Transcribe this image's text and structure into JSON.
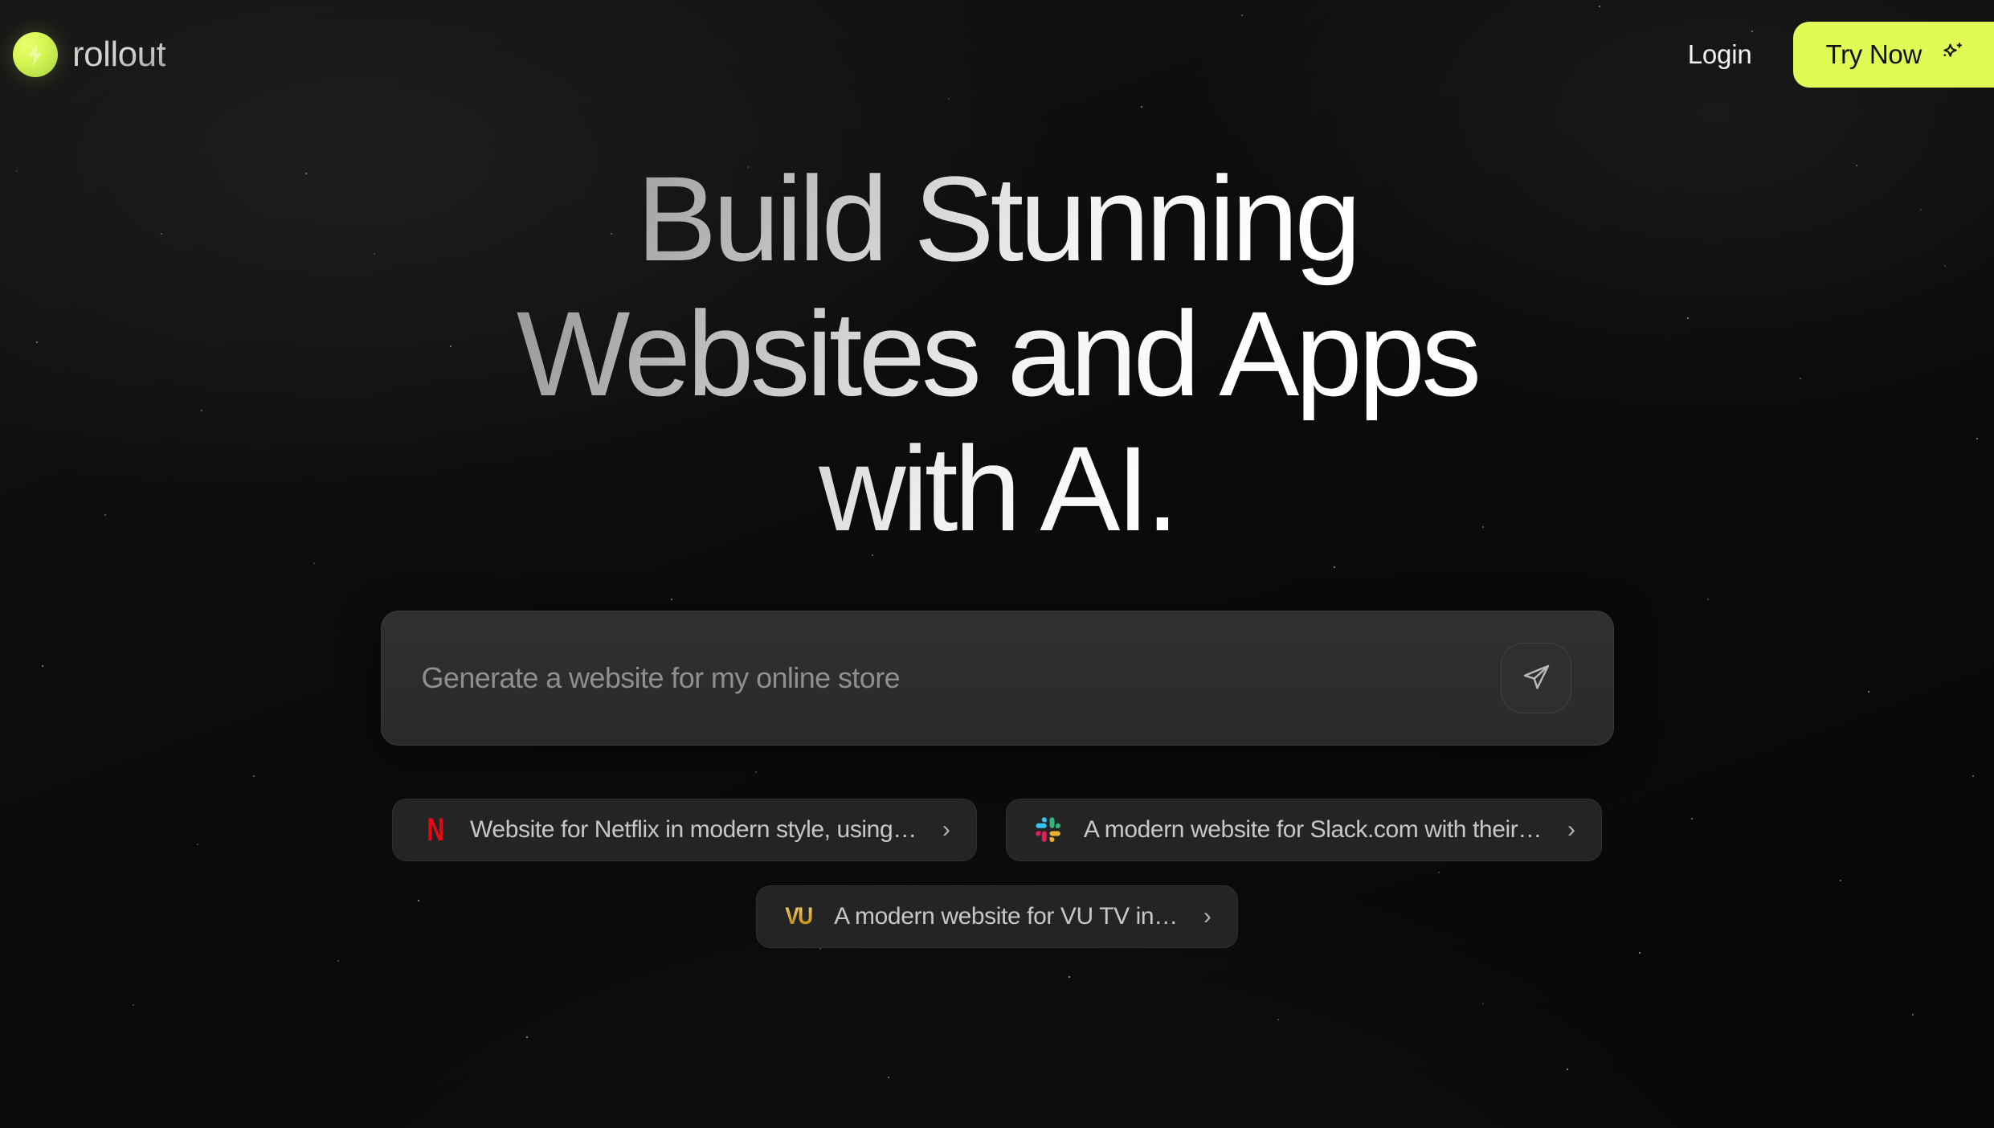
{
  "brand": {
    "name": "rollout",
    "mark_icon": "lightning-bolt-icon",
    "mark_color": "#d6f551"
  },
  "header": {
    "login_label": "Login",
    "try_now_label": "Try Now",
    "try_now_icon": "sparkle-icon",
    "accent_color": "#e1fa55"
  },
  "hero": {
    "headline": "Build Stunning\nWebsites and Apps\nwith AI."
  },
  "prompt": {
    "placeholder": "Generate a website for my online store",
    "value": "",
    "send_icon": "send-paper-plane-icon"
  },
  "suggestions": [
    {
      "logo": "netflix-logo-icon",
      "label": "Website for Netflix in modern style, using…",
      "chevron": "›"
    },
    {
      "logo": "slack-logo-icon",
      "label": "A modern website for Slack.com with their…",
      "chevron": "›"
    },
    {
      "logo": "vu-logo-icon",
      "label": "A modern website for VU TV in…",
      "chevron": "›"
    }
  ]
}
